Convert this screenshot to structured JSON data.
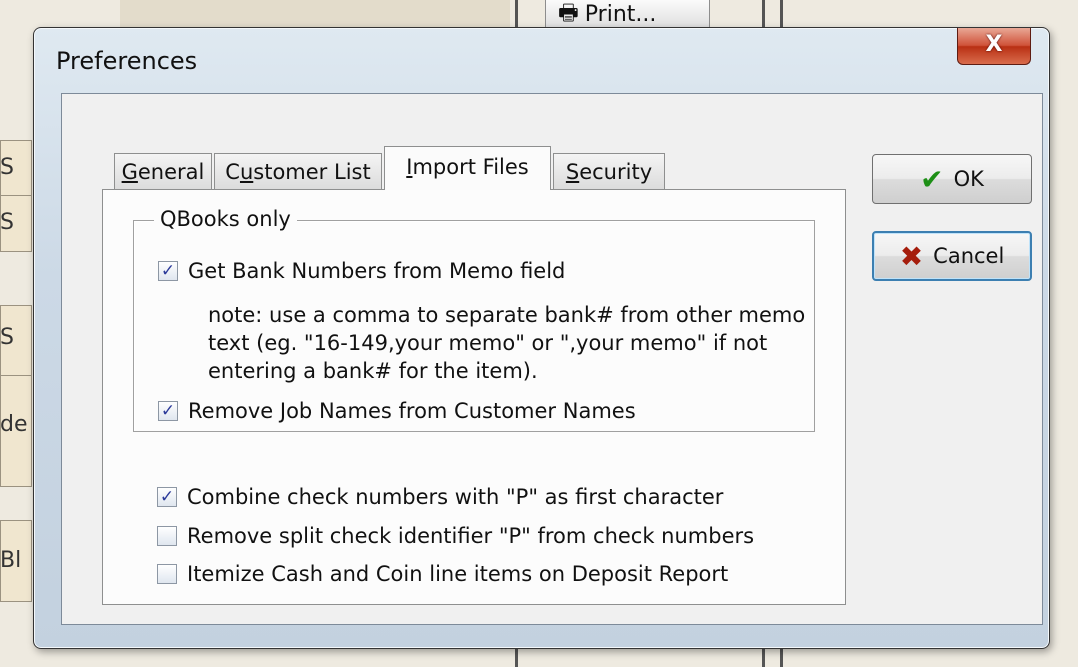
{
  "background": {
    "print_label": "Print...",
    "side_letters": [
      "S",
      "S",
      "S",
      "de",
      "Bl"
    ]
  },
  "dialog": {
    "title": "Preferences",
    "close_glyph": "X",
    "tabs": [
      {
        "mnemonic": "G",
        "rest": "eneral",
        "active": false
      },
      {
        "pre": "C",
        "mnemonic": "u",
        "rest": "stomer List",
        "active": false
      },
      {
        "mnemonic": "I",
        "rest": "mport Files",
        "active": true
      },
      {
        "mnemonic": "S",
        "rest": "ecurity",
        "active": false
      }
    ],
    "group": {
      "label": "QBooks only",
      "get_bank_numbers": {
        "label": "Get Bank Numbers from Memo field",
        "checked": true
      },
      "note": "note: use a comma to separate bank# from other memo text (eg. \"16-149,your memo\" or \",your memo\" if not entering a bank# for the item).",
      "remove_job_names": {
        "label": "Remove Job Names from Customer Names",
        "checked": true
      }
    },
    "options": {
      "combine_check_numbers": {
        "label": "Combine check numbers with \"P\" as first character",
        "checked": true
      },
      "remove_split_identifier": {
        "label": "Remove split check identifier \"P\" from check numbers",
        "checked": false
      },
      "itemize_cash_coin": {
        "label": "Itemize Cash and Coin line items on Deposit Report",
        "checked": false
      }
    },
    "buttons": {
      "ok_label": "OK",
      "cancel_label": "Cancel"
    }
  }
}
